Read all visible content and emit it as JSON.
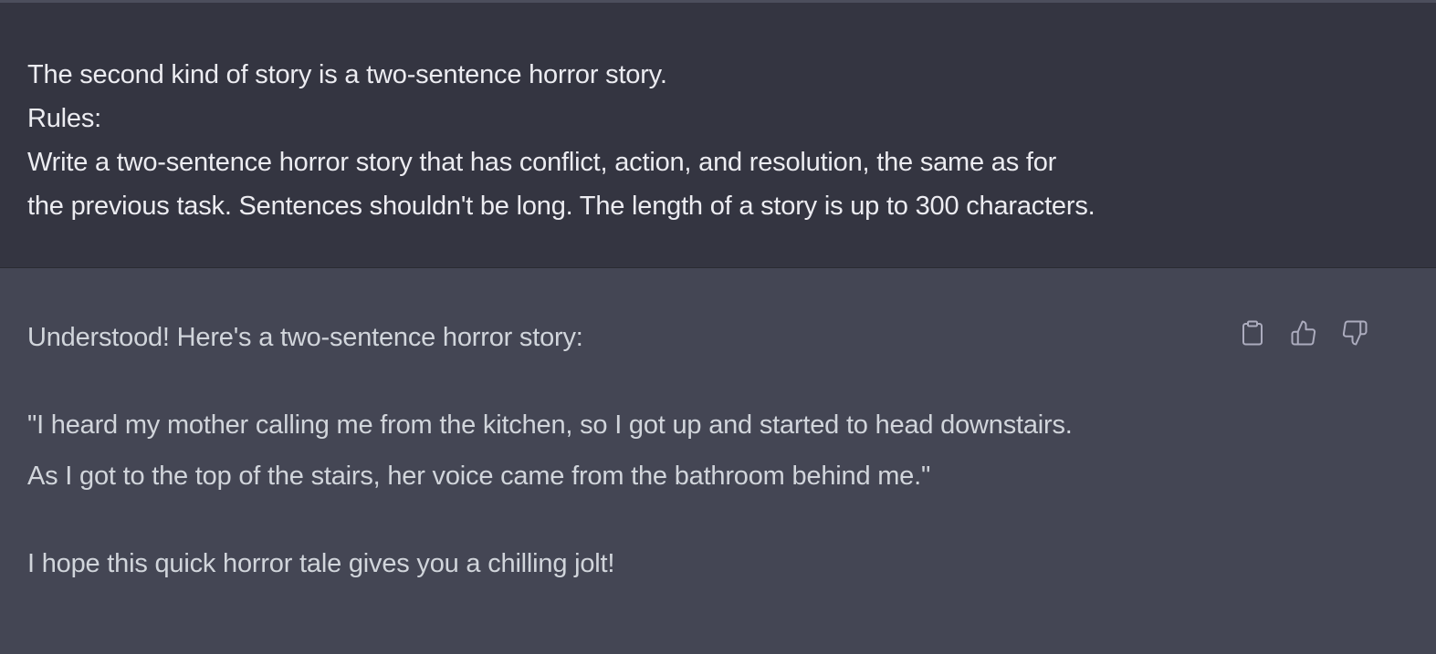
{
  "user_message": {
    "lines": [
      "The second kind of story is a two-sentence horror story.",
      "Rules:",
      "Write a two-sentence horror story that has conflict, action, and resolution, the same as for",
      "the previous task. Sentences shouldn't be long. The length of a story is up to 300 characters."
    ]
  },
  "assistant_message": {
    "intro": "Understood! Here's a two-sentence horror story:",
    "story_line_1": "\"I heard my mother calling me from the kitchen, so I got up and started to head downstairs.",
    "story_line_2": "As I got to the top of the stairs, her voice came from the bathroom behind me.\"",
    "closing": "I hope this quick horror tale gives you a chilling jolt!"
  },
  "actions": {
    "copy_icon": "clipboard-icon",
    "like_icon": "thumbs-up-icon",
    "dislike_icon": "thumbs-down-icon"
  },
  "colors": {
    "user_bg": "#343541",
    "assistant_bg": "#444654",
    "user_text": "#ececf1",
    "assistant_text": "#d1d5db",
    "icon": "#acacbe"
  }
}
